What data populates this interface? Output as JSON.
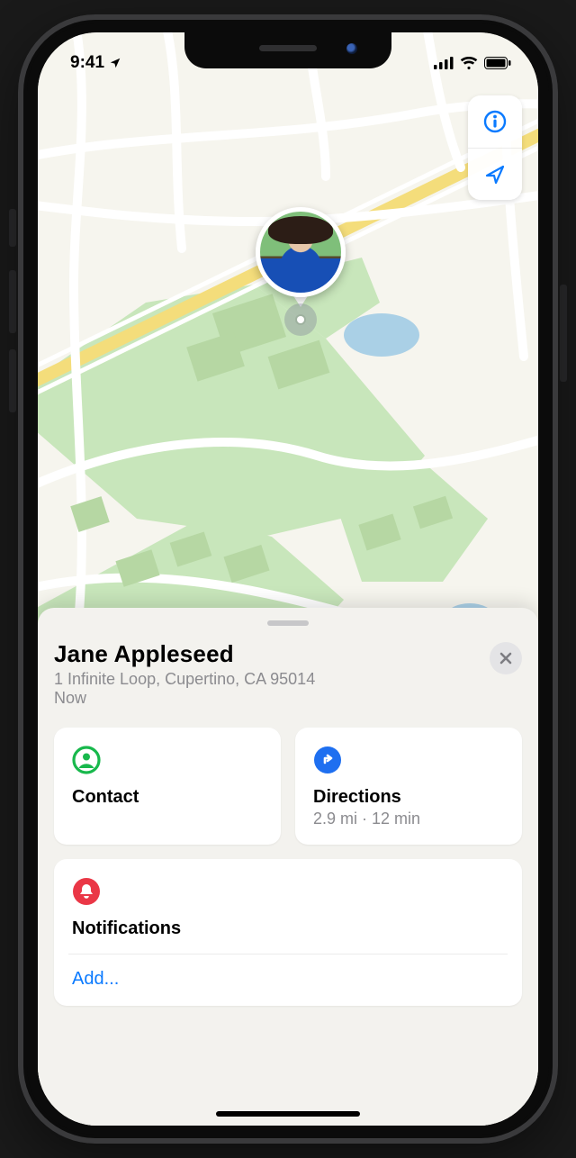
{
  "status_bar": {
    "time": "9:41"
  },
  "person": {
    "name": "Jane Appleseed",
    "address": "1 Infinite Loop, Cupertino, CA 95014",
    "timestamp": "Now"
  },
  "cards": {
    "contact": {
      "label": "Contact"
    },
    "directions": {
      "label": "Directions",
      "detail": "2.9 mi · 12 min"
    },
    "notifications": {
      "label": "Notifications",
      "add_label": "Add..."
    }
  },
  "colors": {
    "accent_blue": "#0a7aff",
    "contact_green": "#18b84c",
    "directions_blue": "#1e6ff0",
    "notifications_red": "#ea3746"
  }
}
